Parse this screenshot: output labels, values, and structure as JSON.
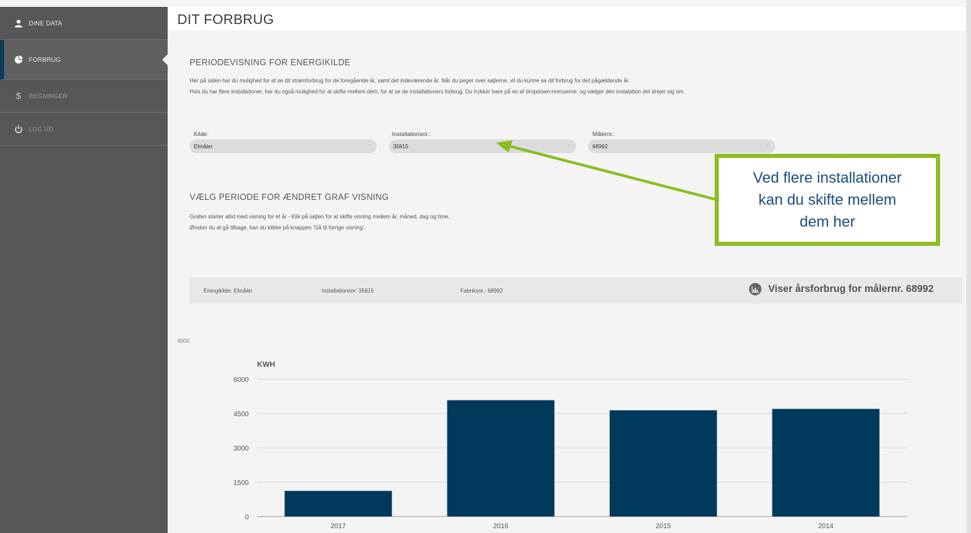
{
  "sidebar": {
    "items": [
      {
        "label": "DINE DATA",
        "icon": "user-icon"
      },
      {
        "label": "FORBRUG",
        "icon": "pie-chart-icon"
      },
      {
        "label": "REGNINGER",
        "icon": "dollar-icon"
      },
      {
        "label": "LOG UD",
        "icon": "power-icon"
      }
    ]
  },
  "header": {
    "title": "DIT FORBRUG"
  },
  "period": {
    "title": "PERIODEVISNING FOR ENERGIKILDE",
    "line1": "Hér på siden har du mulighed for at se dit strømforbrug for de foregående år, samt det indeværende år. Når du peger over søjlerne, vil du kunne se dit forbrug for det pågældende år.",
    "line2": "Hvis du har flere installationer, har du også mulighed for at skifte mellem dem, for at se de installationers forbrug. Du trykker bare på en af dropdown-menuerne, og vælger den instalation det drejer sig om."
  },
  "filters": {
    "kilde": {
      "label": "Kilde:",
      "value": "Elmåler"
    },
    "installation": {
      "label": "Installationsnr.:",
      "value": "35815"
    },
    "maaler": {
      "label": "Målernr.:",
      "value": "68992"
    }
  },
  "graph_section": {
    "title": "VÆLG PERIODE FOR ÆNDRET GRAF VISNING",
    "line1": "Grafen starter altid med visning for et år - Klik på søjlen for at skifte visning mellem år, måned, dag og time.",
    "line2": "Ønsker du at gå tilbage, kan du klikke på knappen 'Gå til forrige visning'."
  },
  "info_bar": {
    "energikilde": "Energikilde: Elmåler",
    "installationsnr": "Installationsnr: 35815",
    "fabriksnr": "Fabriksnr.: 68992",
    "viser": "Viser årsforbrug for målernr. 68992"
  },
  "stray_value": "4000",
  "callout": {
    "line1": "Ved flere installationer",
    "line2": "kan du skifte mellem",
    "line3": "dem her"
  },
  "colors": {
    "bar": "#00395c",
    "sidebar": "#575757",
    "active_marker": "#0a3a5c",
    "callout_border": "#8cbd22",
    "callout_text": "#1b4c7c"
  },
  "chart_data": {
    "type": "bar",
    "categories": [
      "2017",
      "2016",
      "2015",
      "2014"
    ],
    "values": [
      1120,
      5080,
      4640,
      4700
    ],
    "ylabel": "KWH",
    "yticks": [
      0,
      1500,
      3000,
      4500,
      6000
    ],
    "ylim": [
      0,
      6000
    ],
    "grid": true
  }
}
